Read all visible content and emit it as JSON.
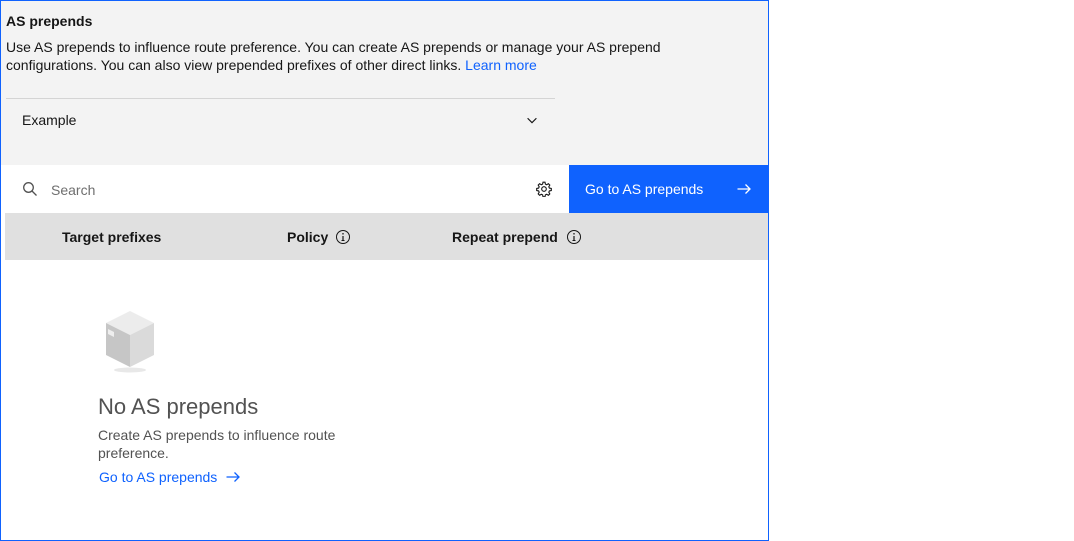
{
  "panel": {
    "title": "AS prepends",
    "description": "Use AS prepends to influence route preference. You can create AS prepends or manage your AS prepend configurations. You can also view prepended prefixes of other direct links.",
    "learn_more": "Learn more",
    "dropdown_value": "Example"
  },
  "toolbar": {
    "search_placeholder": "Search",
    "primary_button": "Go to AS prepends"
  },
  "table": {
    "columns": [
      {
        "label": "Target prefixes",
        "info_icon": false
      },
      {
        "label": "Policy",
        "info_icon": true
      },
      {
        "label": "Repeat prepend",
        "info_icon": true
      }
    ]
  },
  "empty_state": {
    "title": "No AS prepends",
    "description": "Create AS prepends to influence route preference.",
    "link": "Go to AS prepends",
    "icon": "box-icon"
  },
  "colors": {
    "accent": "#0f62fe",
    "header_bg": "#e0e0e0",
    "top_bg": "#f3f3f3"
  }
}
